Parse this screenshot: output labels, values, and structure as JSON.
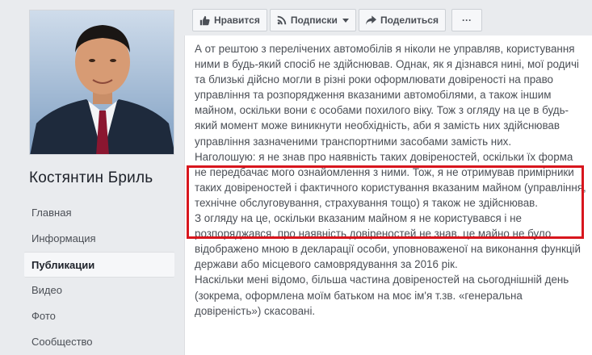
{
  "profile": {
    "name": "Костянтин Бриль"
  },
  "nav": {
    "items": [
      {
        "label": "Главная"
      },
      {
        "label": "Информация"
      },
      {
        "label": "Публикации"
      },
      {
        "label": "Видео"
      },
      {
        "label": "Фото"
      },
      {
        "label": "Сообщество"
      }
    ],
    "active_index": 2
  },
  "toolbar": {
    "like_label": "Нравится",
    "follow_label": "Подписки",
    "share_label": "Поделиться",
    "more_label": "···",
    "icons": [
      "thumbs-up-icon",
      "rss-icon",
      "share-arrow-icon",
      "chevron-down-icon",
      "more-dots-icon"
    ]
  },
  "post": {
    "paragraphs": [
      "А от рештою з перелічених автомобілів я ніколи не управляв, користування ними в будь-який спосіб не здійснював. Однак, як я дізнався нині, мої родичі та близькі дійсно могли в різні роки оформлювати довіреності на право управління та розпорядження вказаними автомобілями, а також іншим майном, оскільки вони є особами похилого віку. Тож з огляду на це в будь-який момент може виникнути необхідність, аби я замість них здійснював управління зазначеними транспортними засобами замість них.",
      "Наголошую: я не знав про наявність таких довіреностей, оскільки їх форма не передбачає мого ознайомлення з ними. Тож, я не отримував примірники таких довіреностей і фактичного користування вказаним майном (управління, технічне обслуговування, страхування тощо) я також не здійснював.",
      "З огляду на це, оскільки вказаним майном я не користувався і не розпоряджався, про наявність довіреностей не знав, це майно не було відображено мною в декларації особи, уповноваженої на виконання функцій держави або місцевого самоврядування за 2016 рік.",
      "Наскільки мені відомо, більша частина довіреностей на сьогоднішній день (зокрема, оформлена моїм батьком на моє ім'я т.зв. «генеральна довіреність») скасовані."
    ]
  },
  "colors": {
    "highlight": "#d8161d",
    "page_bg": "#e9ebee",
    "text": "#4b4f56"
  }
}
